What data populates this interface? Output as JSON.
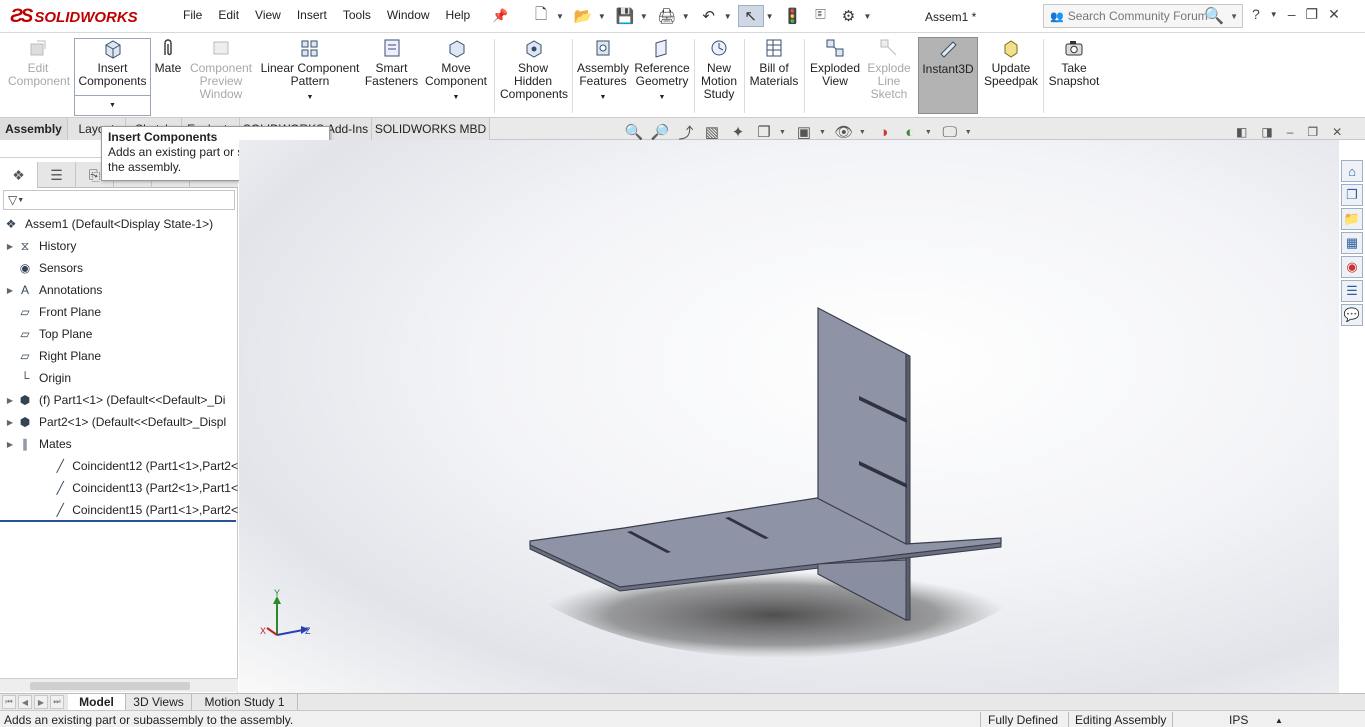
{
  "app": {
    "brand": "SOLIDWORKS",
    "doc_title": "Assem1 *"
  },
  "menu": [
    "File",
    "Edit",
    "View",
    "Insert",
    "Tools",
    "Window",
    "Help"
  ],
  "search": {
    "placeholder": "Search Community Forum"
  },
  "ribbon": {
    "edit_component": "Edit Component",
    "insert_components": "Insert Components",
    "mate": "Mate",
    "component_preview": "Component Preview Window",
    "linear_pattern": "Linear Component Pattern",
    "smart_fasteners": "Smart Fasteners",
    "move_component": "Move Component",
    "show_hidden": "Show Hidden Components",
    "assembly_features": "Assembly Features",
    "reference_geometry": "Reference Geometry",
    "new_motion_study": "New Motion Study",
    "bill_of_materials": "Bill of Materials",
    "exploded_view": "Exploded View",
    "explode_line_sketch": "Explode Line Sketch",
    "instant3d": "Instant3D",
    "update_speedpak": "Update Speedpak",
    "take_snapshot": "Take Snapshot"
  },
  "cm_tabs": [
    "Assembly",
    "Layout",
    "Sketch",
    "Evaluate",
    "SOLIDWORKS Add-Ins",
    "SOLIDWORKS MBD"
  ],
  "tooltip": {
    "title": "Insert Components",
    "body": "Adds an existing part or subassembly to the assembly."
  },
  "tree": [
    {
      "label": "Assem1  (Default<Display State-1>)",
      "icon": "assembly-icon",
      "expandable": false,
      "indent": 0
    },
    {
      "label": "History",
      "icon": "history-icon",
      "expandable": true,
      "indent": 1
    },
    {
      "label": "Sensors",
      "icon": "sensor-icon",
      "expandable": false,
      "indent": 1
    },
    {
      "label": "Annotations",
      "icon": "annotation-icon",
      "expandable": true,
      "indent": 1
    },
    {
      "label": "Front Plane",
      "icon": "plane-icon",
      "expandable": false,
      "indent": 1
    },
    {
      "label": "Top Plane",
      "icon": "plane-icon",
      "expandable": false,
      "indent": 1
    },
    {
      "label": "Right Plane",
      "icon": "plane-icon",
      "expandable": false,
      "indent": 1
    },
    {
      "label": "Origin",
      "icon": "origin-icon",
      "expandable": false,
      "indent": 1
    },
    {
      "label": "(f) Part1<1> (Default<<Default>_Di",
      "icon": "part-icon",
      "expandable": true,
      "indent": 1
    },
    {
      "label": "Part2<1> (Default<<Default>_Displ",
      "icon": "part-icon",
      "expandable": true,
      "indent": 1
    },
    {
      "label": "Mates",
      "icon": "mates-icon",
      "expandable": true,
      "indent": 1
    },
    {
      "label": "Coincident12 (Part1<1>,Part2<",
      "icon": "coincident-icon",
      "expandable": false,
      "indent": 2
    },
    {
      "label": "Coincident13 (Part2<1>,Part1<",
      "icon": "coincident-icon",
      "expandable": false,
      "indent": 2
    },
    {
      "label": "Coincident15 (Part1<1>,Part2<",
      "icon": "coincident-icon",
      "expandable": false,
      "indent": 2
    }
  ],
  "triad": {
    "x": "X",
    "y": "Y",
    "z": "Z"
  },
  "bottom_tabs": [
    "Model",
    "3D Views",
    "Motion Study 1"
  ],
  "status": {
    "message": "Adds an existing part or subassembly to the assembly.",
    "defined": "Fully Defined",
    "mode": "Editing Assembly",
    "units": "IPS"
  },
  "colors": {
    "brand_red": "#c00000",
    "part_face": "#8f93a6",
    "part_edge": "#3a3d4a",
    "selection_blue": "#2a4f9a"
  }
}
